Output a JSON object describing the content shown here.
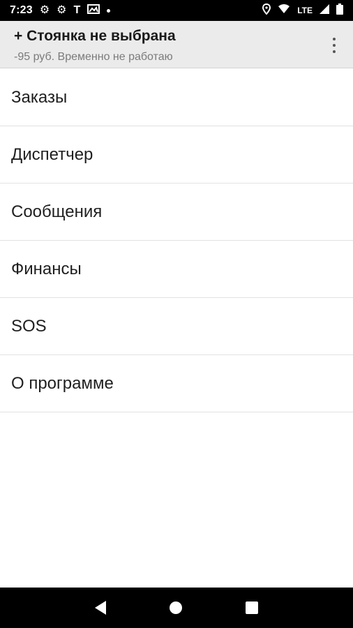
{
  "status_bar": {
    "time": "7:23",
    "icons": [
      "gear-icon",
      "gear-icon",
      "t-icon",
      "image-icon",
      "dot-icon",
      "location-icon",
      "wifi-icon",
      "lte-icon",
      "battery-icon"
    ],
    "lte_label": "LTE"
  },
  "header": {
    "title": "+ Стоянка не выбрана",
    "subtitle": "-95 руб. Временно не работаю",
    "menu_icon": "overflow-menu-icon"
  },
  "menu": {
    "items": [
      {
        "label": "Заказы"
      },
      {
        "label": "Диспетчер"
      },
      {
        "label": "Сообщения"
      },
      {
        "label": "Финансы"
      },
      {
        "label": "SOS"
      },
      {
        "label": "О программе"
      }
    ]
  },
  "nav_bar": {
    "buttons": [
      "back-icon",
      "home-icon",
      "recents-icon"
    ]
  },
  "colors": {
    "header_bg": "#ebebeb",
    "status_bar_bg": "#000000",
    "divider": "#e2e2e2"
  }
}
